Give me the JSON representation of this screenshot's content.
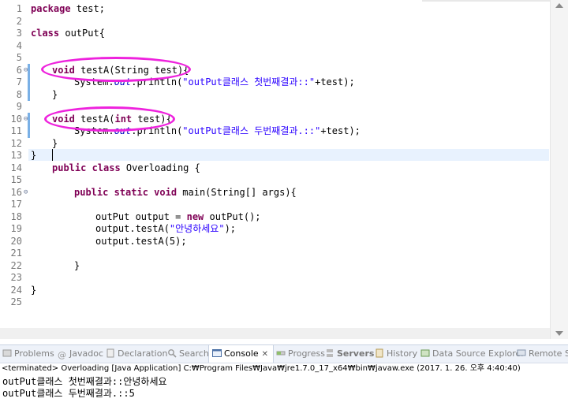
{
  "editor": {
    "line_numbers": [
      "1",
      "2",
      "3",
      "4",
      "5",
      "6",
      "7",
      "8",
      "9",
      "10",
      "11",
      "12",
      "13",
      "14",
      "15",
      "16",
      "17",
      "18",
      "19",
      "20",
      "21",
      "22",
      "23",
      "24",
      "25"
    ],
    "fold_markers": [
      "⊖",
      "⊖",
      "⊖"
    ],
    "lines": {
      "l1_kw": "package",
      "l1_rest": " test;",
      "l3_kw": "class",
      "l3_rest": " outPut{",
      "l6_kw": "void",
      "l6_rest": " testA(String test){",
      "l7_a": "System.",
      "l7_field": "out",
      "l7_b": ".println(",
      "l7_str": "\"outPut클래스 첫번째결과::\"",
      "l7_c": "+test);",
      "l8": "}",
      "l10_kw": "void",
      "l10_a": " testA(",
      "l10_kw2": "int",
      "l10_b": " test){",
      "l11_a": "System.",
      "l11_field": "out",
      "l11_b": ".println(",
      "l11_str": "\"outPut클래스 두번째결과.::\"",
      "l11_c": "+test);",
      "l12": "}",
      "l13": "}",
      "l14_kw": "public class",
      "l14_rest": " Overloading {",
      "l16_kw": "public static void",
      "l16_rest": " main(String[] args){",
      "l18_a": "outPut output = ",
      "l18_kw": "new",
      "l18_b": " outPut();",
      "l19_a": "output.testA(",
      "l19_str": "\"안녕하세요\"",
      "l19_b": ");",
      "l20": "output.testA(5);",
      "l22": "}",
      "l24": "}"
    }
  },
  "tabs": {
    "problems": "Problems",
    "javadoc": "Javadoc",
    "declaration": "Declaration",
    "search": "Search",
    "console": "Console",
    "console_close": "✕",
    "progress": "Progress",
    "servers": "Servers",
    "history": "History",
    "datasource": "Data Source Explorer",
    "remote": "Remote Sy"
  },
  "console": {
    "header": "<terminated> Overloading [Java Application] C:₩Program Files₩Java₩jre1.7.0_17_x64₩bin₩javaw.exe (2017. 1. 26. 오후 4:40:40)",
    "output": [
      "outPut클래스 첫번째결과::안녕하세요",
      "outPut클래스 두번째결과.::5"
    ]
  },
  "colors": {
    "keyword": "#7f0055",
    "string": "#2a00ff",
    "field": "#0000c0",
    "annotation": "#ee22dd"
  }
}
